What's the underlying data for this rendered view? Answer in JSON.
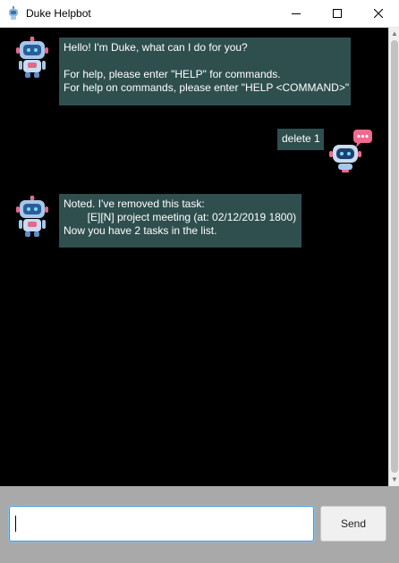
{
  "window": {
    "title": "Duke Helpbot",
    "icons": [
      "robot-app-icon",
      "minimize-icon",
      "maximize-icon",
      "close-icon"
    ]
  },
  "messages": [
    {
      "sender": "bot",
      "avatar": "robot-avatar-icon",
      "text": "Hello! I'm Duke, what can I do for you?\n\nFor help, please enter \"HELP\" for commands.\nFor help on commands, please enter \"HELP <COMMAND>\""
    },
    {
      "sender": "user",
      "avatar": "robot-chat-avatar-icon",
      "text": "delete 1"
    },
    {
      "sender": "bot",
      "avatar": "robot-avatar-icon",
      "text": "Noted. I've removed this task:\n        [E][N] project meeting (at: 02/12/2019 1800)\nNow you have 2 tasks in the list."
    }
  ],
  "input": {
    "value": "",
    "placeholder": ""
  },
  "send_button": {
    "label": "Send"
  },
  "colors": {
    "chat_background": "#000000",
    "bubble": "#2f4f4f",
    "bubble_text": "#ffffff",
    "input_area": "#a9a9a9",
    "input_focus": "#3d96d6"
  }
}
